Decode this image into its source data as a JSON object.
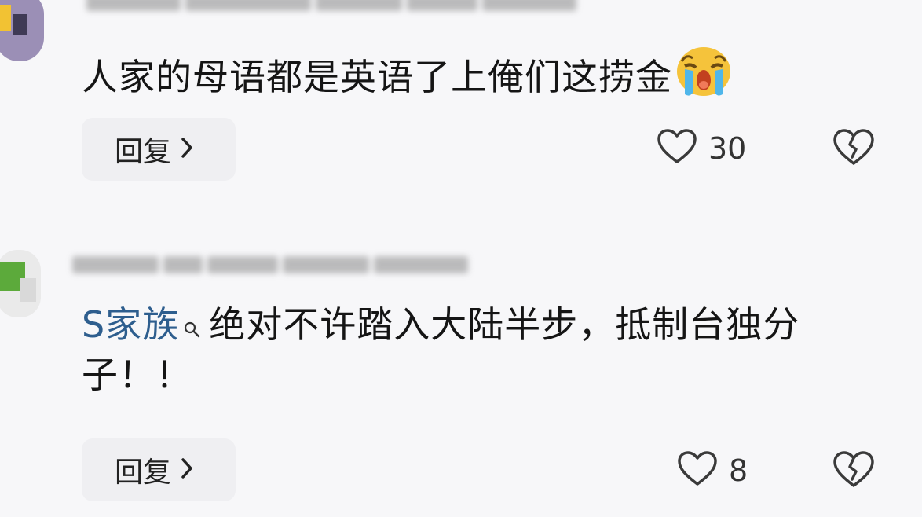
{
  "comments": [
    {
      "text": "人家的母语都是英语了上俺们这捞金",
      "reply_label": "回复",
      "like_count": "30",
      "emoji": "crying-face-icon"
    },
    {
      "topic": "S家族",
      "text": "绝对不许踏入大陆半步，抵制台独分子！！",
      "reply_label": "回复",
      "like_count": "8"
    }
  ],
  "colors": {
    "background": "#f7f7f9",
    "topic_link": "#2e5e8e",
    "reply_button_bg": "#efeff2"
  }
}
